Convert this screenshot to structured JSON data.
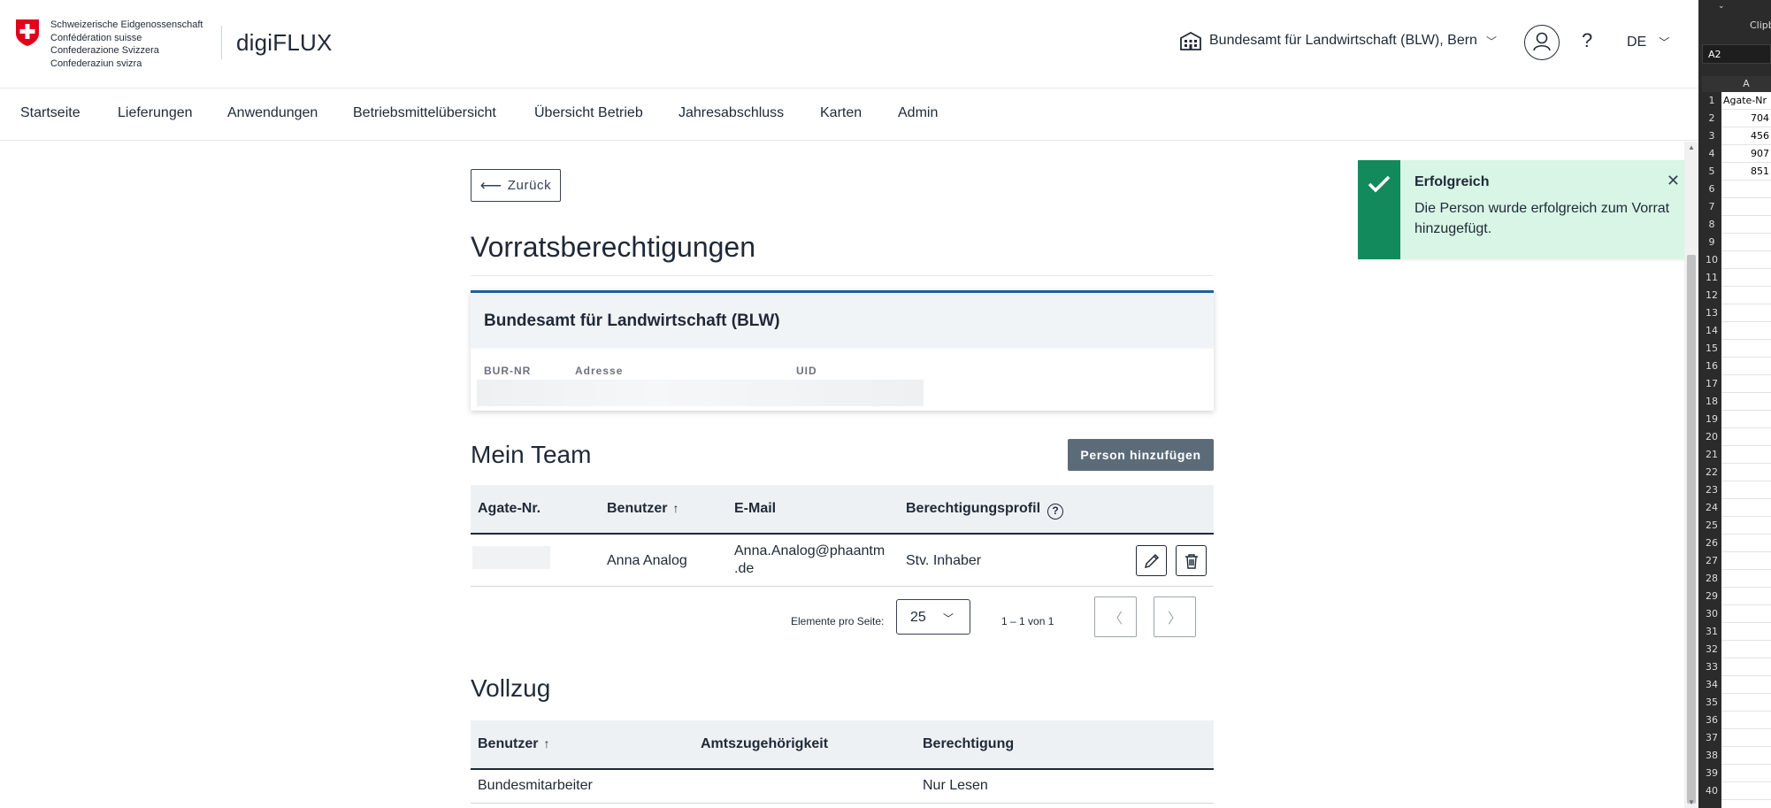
{
  "header": {
    "confederation_lines": [
      "Schweizerische Eidgenossenschaft",
      "Confédération suisse",
      "Confederazione Svizzera",
      "Confederaziun svizra"
    ],
    "brand": "digiFLUX",
    "organization": "Bundesamt für Landwirtschaft (BLW), Bern",
    "help": "?",
    "language": "DE"
  },
  "nav": {
    "items": [
      "Startseite",
      "Lieferungen",
      "Anwendungen",
      "Betriebsmittelübersicht",
      "Übersicht Betrieb",
      "Jahresabschluss",
      "Karten",
      "Admin"
    ]
  },
  "back_label": "Zurück",
  "page_title": "Vorratsberechtigungen",
  "org_card": {
    "name": "Bundesamt für Landwirtschaft (BLW)",
    "labels": [
      "BUR-NR",
      "Adresse",
      "UID"
    ]
  },
  "team": {
    "title": "Mein Team",
    "add_button": "Person hinzufügen",
    "columns": [
      "Agate-Nr.",
      "Benutzer",
      "E-Mail",
      "Berechtigungsprofil"
    ],
    "rows": [
      {
        "agate": "",
        "user": "Anna Analog",
        "email_line1": "Anna.Analog@phaantm",
        "email_line2": ".de",
        "profile": "Stv. Inhaber"
      }
    ],
    "pager": {
      "per_page_label": "Elemente pro Seite:",
      "per_page": "25",
      "range": "1 – 1 von 1"
    }
  },
  "vollzug": {
    "title": "Vollzug",
    "columns": [
      "Benutzer",
      "Amtszugehörigkeit",
      "Berechtigung"
    ],
    "rows": [
      {
        "user": "Bundesmitarbeiter",
        "office": "",
        "permission": "Nur Lesen"
      }
    ]
  },
  "toast": {
    "title": "Erfolgreich",
    "message": "Die Person wurde erfolgreich zum Vorrat hinzugefügt.",
    "color": "#138a5b"
  },
  "excel": {
    "ribbon_label": "Clipbo",
    "namebox": "A2",
    "column": "A",
    "cells": [
      "Agate-Nr",
      "704",
      "456",
      "907",
      "851"
    ],
    "row_numbers": [
      "1",
      "2",
      "3",
      "4",
      "5",
      "6",
      "7",
      "8",
      "9",
      "10",
      "11",
      "12",
      "13",
      "14",
      "15",
      "16",
      "17",
      "18",
      "19",
      "20",
      "21",
      "22",
      "23",
      "24",
      "25",
      "26",
      "27",
      "28",
      "29",
      "30",
      "31",
      "32",
      "33",
      "34",
      "35",
      "36",
      "37",
      "38",
      "39",
      "40"
    ]
  }
}
